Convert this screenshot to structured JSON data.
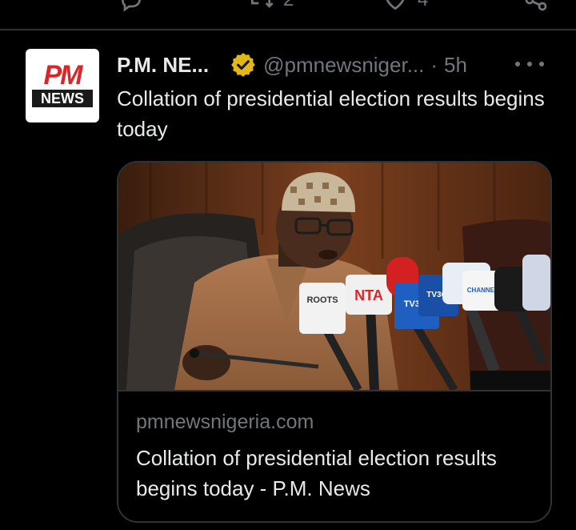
{
  "previous_tweet": {
    "retweet_count": "2",
    "like_count": "4"
  },
  "tweet": {
    "author_name": "P.M. NE...",
    "handle": "@pmnewsniger...",
    "separator": "·",
    "time": "5h",
    "text": "Collation of presidential election results begins today",
    "avatar": {
      "logo_top": "PM",
      "logo_bottom": "NEWS"
    },
    "card": {
      "domain": "pmnewsnigeria.com",
      "title": "Collation of presidential election results begins today - P.M. News",
      "mic_labels": [
        "ROOTS",
        "NTA",
        "TV360",
        "TV360",
        "CHANNELS"
      ]
    }
  },
  "colors": {
    "background": "#000000",
    "text": "#e7e9ea",
    "secondary": "#71767b",
    "border": "#2f3336",
    "verified_gold": "#e2b719",
    "brand_red": "#d9262b"
  },
  "icons": [
    "reply-icon",
    "retweet-icon",
    "like-icon",
    "share-icon",
    "verified-badge-icon",
    "more-icon"
  ]
}
